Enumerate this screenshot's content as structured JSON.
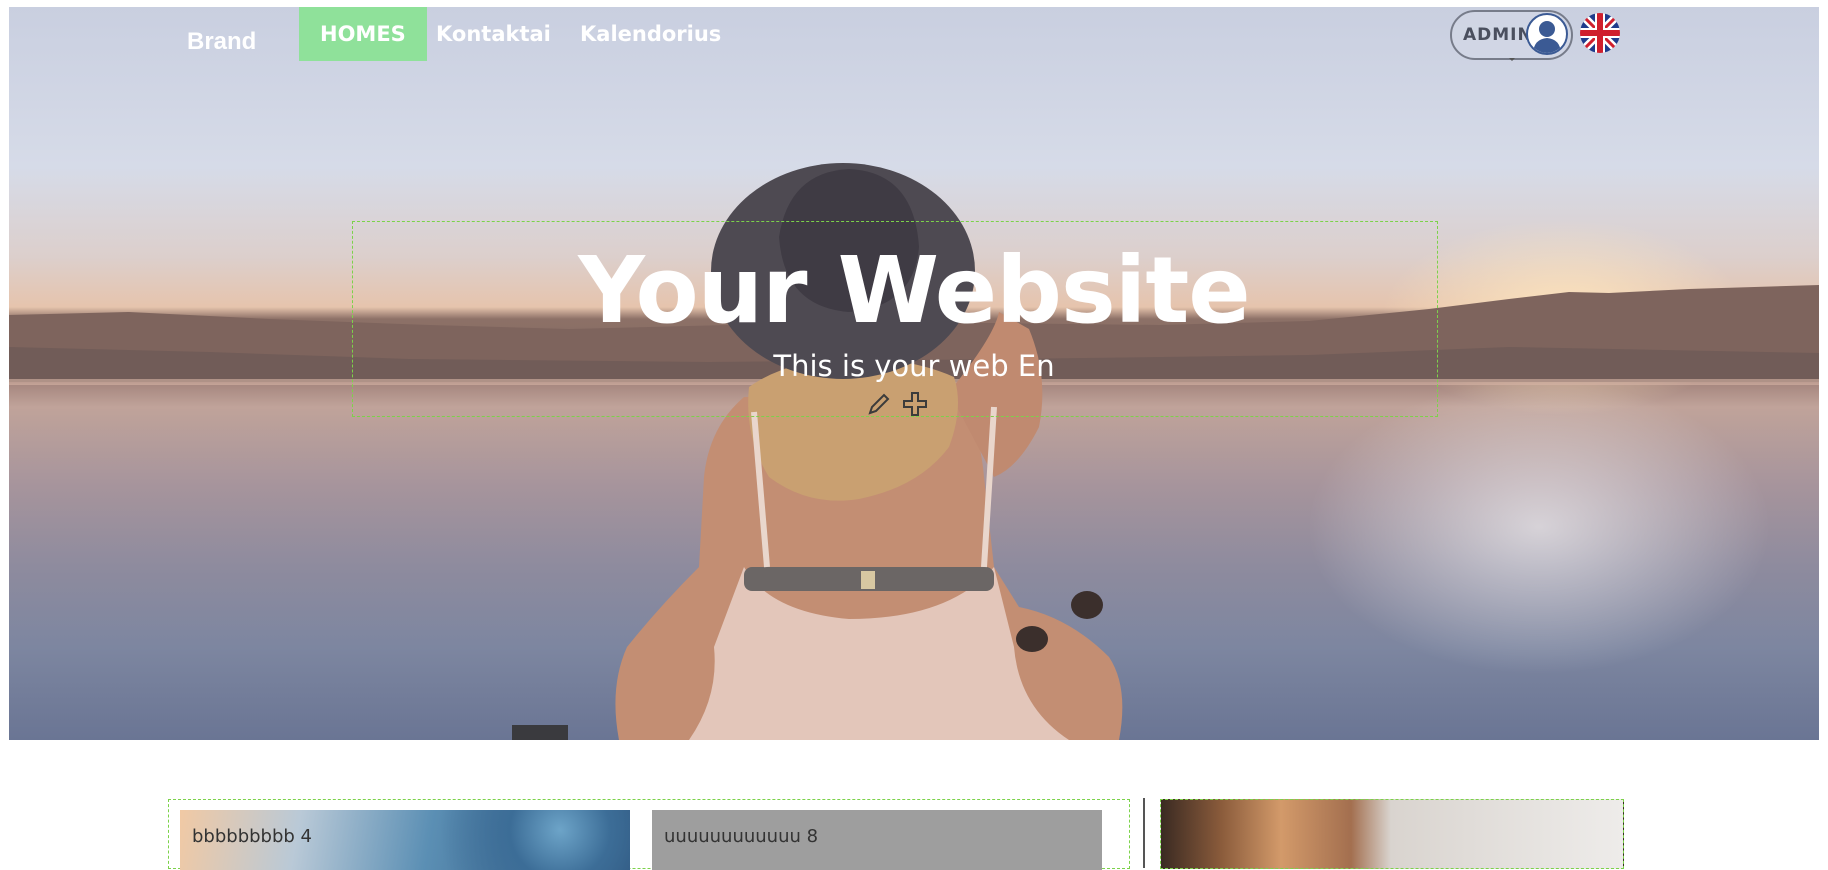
{
  "nav": {
    "brand": "Brand",
    "items": [
      {
        "label": "HOMES",
        "active": true
      },
      {
        "label": "Kontaktai",
        "active": false
      },
      {
        "label": "Kalendorius",
        "active": false
      }
    ],
    "active_color": "#8fe19a"
  },
  "admin": {
    "label": "ADMIN",
    "avatar_icon": "user-avatar-icon",
    "language_icon": "uk-flag-icon"
  },
  "hero": {
    "title": "Your Website",
    "subtitle": "This is your web En",
    "tools": [
      "edit-pencil-icon",
      "move-cross-icon"
    ]
  },
  "cards": [
    {
      "label": "bbbbbbbbb 4"
    },
    {
      "label": "uuuuuuuuuuuu 8"
    }
  ],
  "colors": {
    "edit_outline": "#7cd24a",
    "accent": "#8fe19a"
  }
}
